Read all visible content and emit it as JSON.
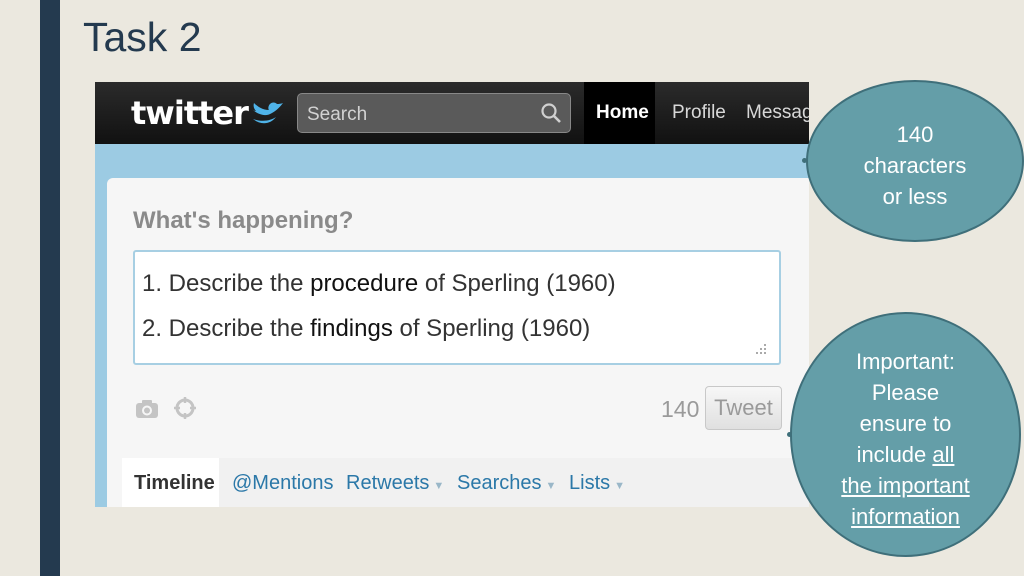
{
  "slide": {
    "title": "Task 2"
  },
  "twitter": {
    "logo_text": "twitter",
    "search_placeholder": "Search",
    "nav": [
      "Home",
      "Profile",
      "Message"
    ],
    "prompt": "What's happening?",
    "textbox": {
      "line1_prefix": "1. Describe the ",
      "line1_keyword": "procedure",
      "line1_suffix": " of Sperling (1960)",
      "line2_prefix": "2. Describe the ",
      "line2_keyword": "findings",
      "line2_suffix": " of Sperling (1960)"
    },
    "char_count": "140",
    "tweet_button": "Tweet",
    "tabs": [
      "Timeline",
      "@Mentions",
      "Retweets",
      "Searches",
      "Lists"
    ]
  },
  "bubble_chars": {
    "l1": "140",
    "l2": "characters",
    "l3": "or less"
  },
  "bubble_important": {
    "l1": "Important:",
    "l2": "Please",
    "l3": "ensure to",
    "l4_pre": "include ",
    "l4_u": "all",
    "l5": "the important",
    "l6": "information"
  },
  "colors": {
    "accent": "#243a4f",
    "bubble": "#649ea8",
    "twitter_bg": "#9ccbe3"
  }
}
